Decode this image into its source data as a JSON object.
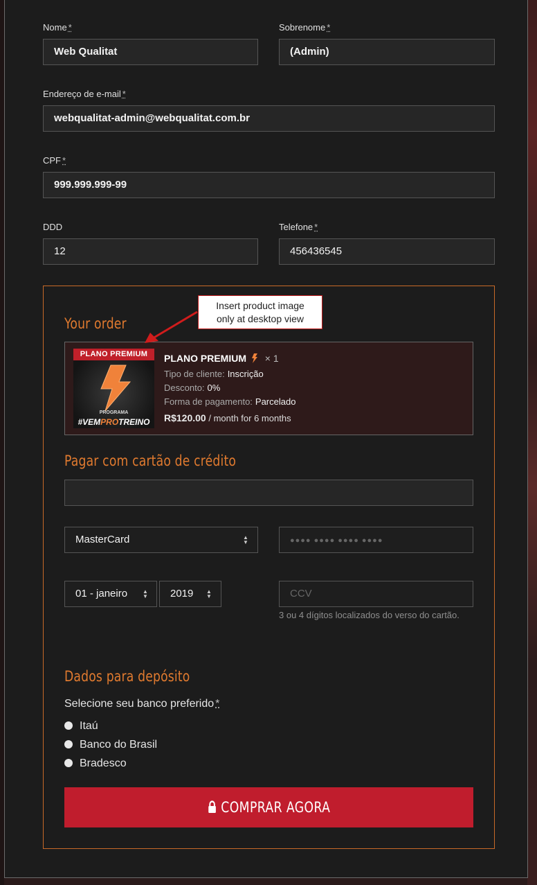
{
  "form": {
    "first_name": {
      "label": "Nome",
      "value": "Web Qualitat"
    },
    "last_name": {
      "label": "Sobrenome",
      "value": "(Admin)"
    },
    "email": {
      "label": "Endereço de e-mail",
      "value": "webqualitat-admin@webqualitat.com.br"
    },
    "cpf": {
      "label": "CPF",
      "value": "999.999.999-99"
    },
    "ddd": {
      "label": "DDD",
      "value": "12"
    },
    "phone": {
      "label": "Telefone",
      "value": "456436545"
    },
    "required_mark": "*"
  },
  "order": {
    "title": "Your order",
    "product": {
      "image_banner": "PLANO PREMIUM",
      "image_tag_prefix": "#VEM",
      "image_tag_highlight": "PRO",
      "image_tag_suffix": "TREINO",
      "image_tag_small": "PROGRAMA",
      "name": "PLANO PREMIUM",
      "quantity": "× 1",
      "client_type_label": "Tipo de cliente:",
      "client_type_value": "Inscrição",
      "discount_label": "Desconto:",
      "discount_value": "0%",
      "payment_label": "Forma de pagamento:",
      "payment_value": "Parcelado",
      "price": "R$120.00",
      "price_suffix": "/ month for 6 months"
    }
  },
  "card": {
    "title": "Pagar com cartão de crédito",
    "name_value": "",
    "brand": "MasterCard",
    "number_placeholder": "●●●● ●●●● ●●●● ●●●●",
    "month": "01 - janeiro",
    "year": "2019",
    "ccv_placeholder": "CCV",
    "ccv_hint": "3 ou 4 dígitos localizados do verso do cartão."
  },
  "deposit": {
    "title": "Dados para depósito",
    "bank_label": "Selecione seu banco preferido",
    "banks": [
      "Itaú",
      "Banco do Brasil",
      "Bradesco"
    ]
  },
  "buy_button": "COMPRAR AGORA",
  "callout": {
    "line1": "Insert product image",
    "line2": "only at desktop view"
  },
  "colors": {
    "accent": "#e07a2f",
    "button": "#c01d2d",
    "panel": "#1c1c1c"
  }
}
